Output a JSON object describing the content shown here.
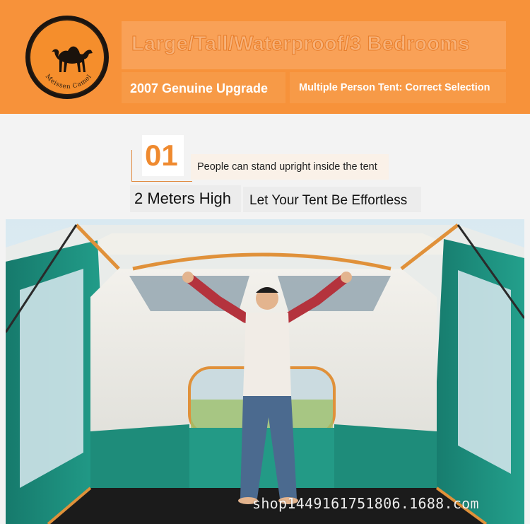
{
  "banner": {
    "headline": "Large/Tall/Waterproof/3 Bedrooms",
    "sub_left": "2007 Genuine Upgrade",
    "sub_right": "Multiple Person Tent: Correct Selection",
    "logo": {
      "icon": "camel-icon",
      "text": "Meissen Camel"
    }
  },
  "feature": {
    "number": "01",
    "description": "People can stand upright inside the tent",
    "height": "2 Meters High",
    "tagline": "Let Your Tent Be Effortless"
  },
  "photo": {
    "watermark": "shop1449161751806.1688.com"
  },
  "colors": {
    "banner_orange": "#f7923a",
    "accent_orange": "#ef8a2f",
    "tent_green": "#1f8a7a"
  }
}
